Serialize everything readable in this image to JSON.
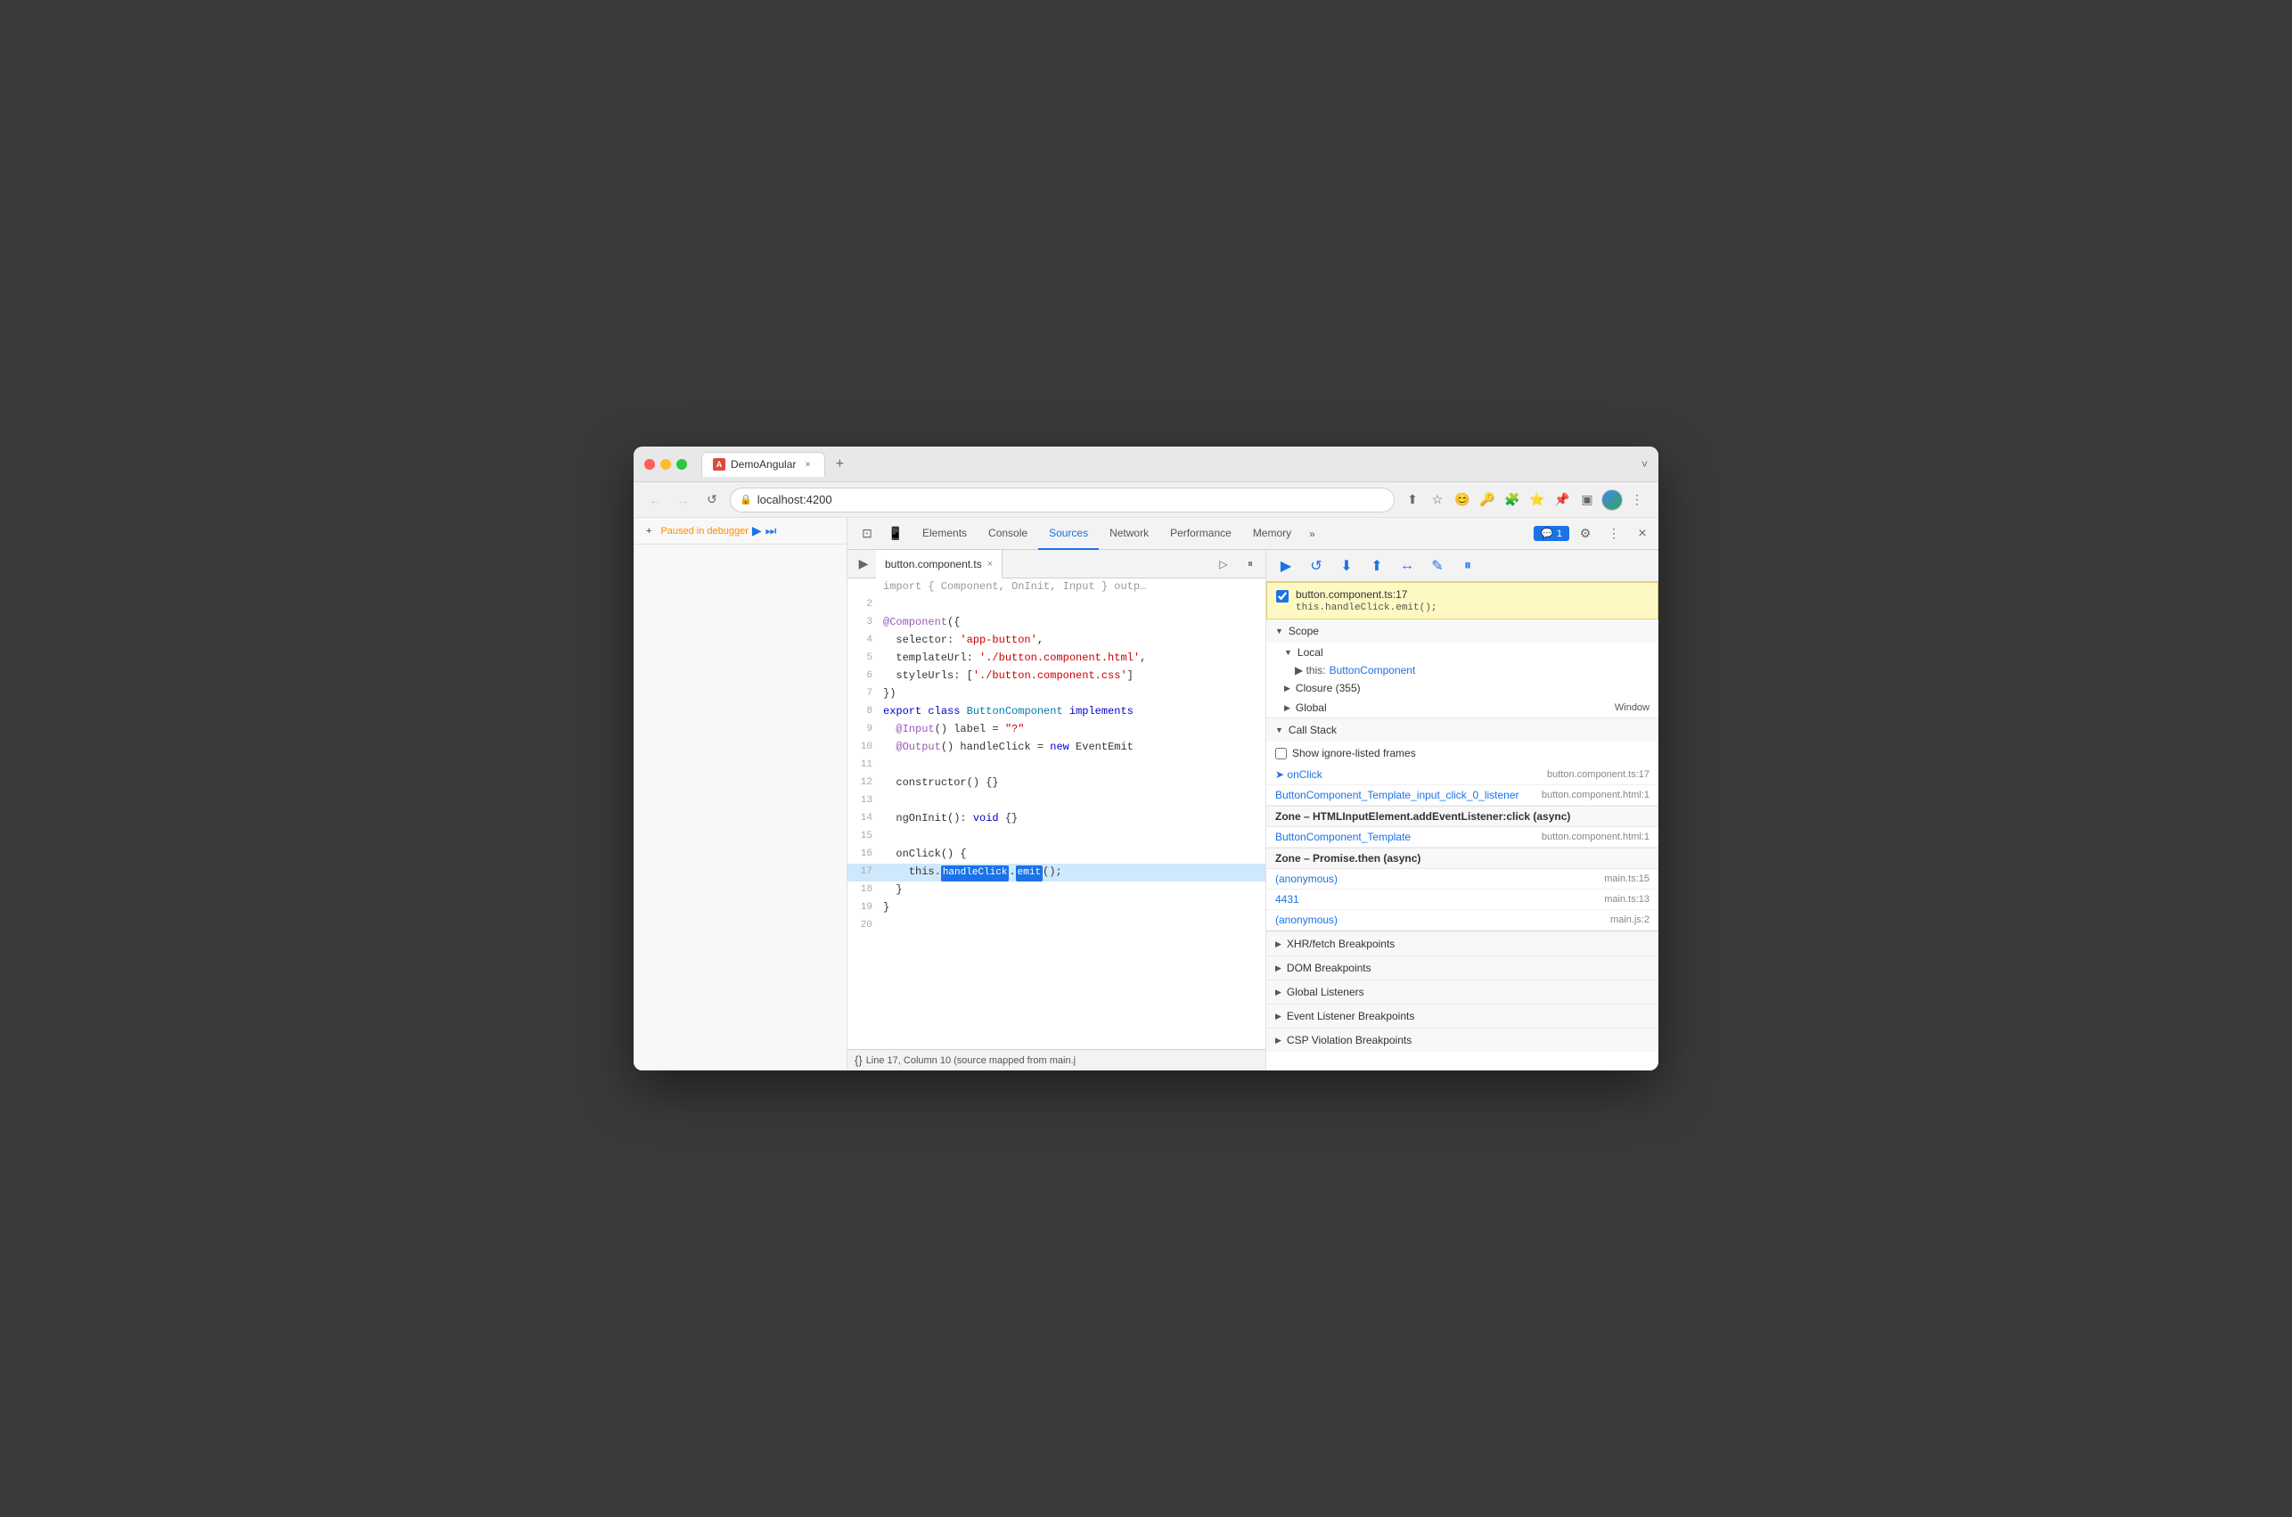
{
  "browser": {
    "tab_title": "DemoAngular",
    "tab_close": "×",
    "tab_add": "+",
    "tab_menu": "˅",
    "url": "localhost:4200",
    "nav": {
      "back": "←",
      "forward": "→",
      "reload": "↺"
    }
  },
  "address_icons": [
    "⬆",
    "☆",
    "😀",
    "🔑",
    "🧩",
    "⭐",
    "📍",
    "👤",
    "⋮"
  ],
  "devtools": {
    "tabs": [
      "Elements",
      "Console",
      "Sources",
      "Network",
      "Performance",
      "Memory"
    ],
    "active_tab": "Sources",
    "overflow": "»",
    "badge_count": "1",
    "settings_icon": "⚙",
    "more_icon": "⋮",
    "close_icon": "×"
  },
  "left_sidebar": {
    "add_btn": "+",
    "cursor_btn": "⊡",
    "paused_label": "Paused in debugger",
    "resume_icon": "▶",
    "step_icon": "⏭"
  },
  "editor": {
    "file_name": "button.component.ts",
    "close_icon": "×",
    "pause_icon": "⏸",
    "format_icon": "{ }",
    "lines": [
      {
        "num": "2",
        "content": ""
      },
      {
        "num": "3",
        "content": "@Component({"
      },
      {
        "num": "4",
        "content": "  selector: 'app-button',"
      },
      {
        "num": "5",
        "content": "  templateUrl: './button.component.html',"
      },
      {
        "num": "6",
        "content": "  styleUrls: ['./button.component.css']"
      },
      {
        "num": "7",
        "content": "})"
      },
      {
        "num": "8",
        "content": "export class ButtonComponent implements"
      },
      {
        "num": "9",
        "content": "  @Input() label = \"?\""
      },
      {
        "num": "10",
        "content": "  @Output() handleClick = new EventEmit"
      },
      {
        "num": "11",
        "content": ""
      },
      {
        "num": "12",
        "content": "  constructor() {}"
      },
      {
        "num": "13",
        "content": ""
      },
      {
        "num": "14",
        "content": "  ngOnInit(): void {}"
      },
      {
        "num": "15",
        "content": ""
      },
      {
        "num": "16",
        "content": "  onClick() {"
      },
      {
        "num": "17",
        "content": "    this.handleClick.emit();",
        "highlighted": true
      },
      {
        "num": "18",
        "content": "  }"
      },
      {
        "num": "19",
        "content": "}"
      },
      {
        "num": "20",
        "content": ""
      }
    ],
    "status_bar": "Line 17, Column 10 (source mapped from main.j",
    "format_btn": "{}"
  },
  "debugger": {
    "toolbar_buttons": [
      "▶",
      "↺",
      "⬇",
      "⬆",
      "↔",
      "✎",
      "⏸"
    ],
    "breakpoint": {
      "file": "button.component.ts:17",
      "code": "this.handleClick.emit();"
    },
    "scope": {
      "title": "Scope",
      "local": {
        "label": "Local",
        "items": [
          {
            "key": "▶ this",
            "value": "ButtonComponent"
          }
        ]
      },
      "closure": {
        "label": "Closure (355)"
      },
      "global": {
        "label": "Global",
        "value": "Window"
      }
    },
    "call_stack": {
      "title": "Call Stack",
      "show_ignored": "Show ignore-listed frames",
      "items": [
        {
          "name": "onClick",
          "file": "button.component.ts:17",
          "current": true
        },
        {
          "name": "ButtonComponent_Template_input_click_0_listener",
          "file": "button.component.html:1"
        },
        {
          "name": "Zone – HTMLInputElement.addEventListener:click (async)",
          "is_zone": true
        },
        {
          "name": "ButtonComponent_Template",
          "file": "button.component.html:1"
        },
        {
          "name": "Zone – Promise.then (async)",
          "is_zone": true
        },
        {
          "name": "(anonymous)",
          "file": "main.ts:15"
        },
        {
          "name": "4431",
          "file": "main.ts:13"
        },
        {
          "name": "(anonymous)",
          "file": "main.js:2"
        }
      ]
    },
    "sections": [
      {
        "label": "XHR/fetch Breakpoints"
      },
      {
        "label": "DOM Breakpoints"
      },
      {
        "label": "Global Listeners"
      },
      {
        "label": "Event Listener Breakpoints"
      },
      {
        "label": "CSP Violation Breakpoints"
      }
    ]
  }
}
